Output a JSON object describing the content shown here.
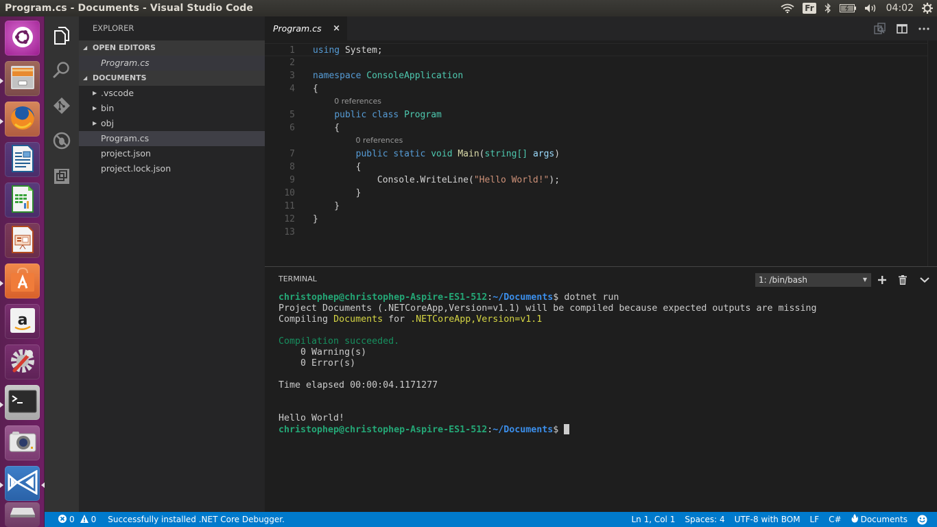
{
  "window": {
    "title": "Program.cs - Documents - Visual Studio Code"
  },
  "top_panel": {
    "keyboard_layout": "Fr",
    "clock": "04:02",
    "icons": [
      "wifi-icon",
      "keyboard-layout-indicator",
      "bluetooth-icon",
      "battery-icon",
      "volume-icon",
      "power-gear-icon"
    ]
  },
  "launcher": {
    "items": [
      {
        "name": "ubuntu-dash",
        "icon": "ubuntu-logo-icon",
        "running": false
      },
      {
        "name": "files",
        "icon": "file-cabinet-icon",
        "running": true
      },
      {
        "name": "firefox",
        "icon": "firefox-icon",
        "running": true
      },
      {
        "name": "libreoffice-writer",
        "icon": "writer-document-icon",
        "running": false
      },
      {
        "name": "libreoffice-calc",
        "icon": "calc-spreadsheet-icon",
        "running": false
      },
      {
        "name": "libreoffice-impress",
        "icon": "impress-presentation-icon",
        "running": false
      },
      {
        "name": "ubuntu-software",
        "icon": "software-center-bag-icon",
        "running": true
      },
      {
        "name": "amazon",
        "icon": "amazon-icon",
        "running": false
      },
      {
        "name": "system-settings",
        "icon": "settings-wrench-icon",
        "running": false
      },
      {
        "name": "terminal",
        "icon": "terminal-icon",
        "running": true
      },
      {
        "name": "shotwell",
        "icon": "camera-icon",
        "running": false
      },
      {
        "name": "visual-studio-code",
        "icon": "vscode-icon",
        "running": true,
        "focused": true
      },
      {
        "name": "removable-drive",
        "icon": "drive-icon",
        "running": false
      }
    ]
  },
  "activity_bar": {
    "items": [
      {
        "name": "explorer",
        "icon": "files-icon",
        "active": true
      },
      {
        "name": "search",
        "icon": "search-icon",
        "active": false
      },
      {
        "name": "source-control",
        "icon": "git-icon",
        "active": false
      },
      {
        "name": "debug",
        "icon": "debug-no-bug-icon",
        "active": false
      },
      {
        "name": "extensions",
        "icon": "extensions-icon",
        "active": false
      }
    ]
  },
  "sidebar": {
    "title": "EXPLORER",
    "open_editors": {
      "label": "OPEN EDITORS",
      "files": [
        "Program.cs"
      ]
    },
    "folder": {
      "label": "DOCUMENTS",
      "items": [
        {
          "name": ".vscode",
          "type": "folder"
        },
        {
          "name": "bin",
          "type": "folder"
        },
        {
          "name": "obj",
          "type": "folder"
        },
        {
          "name": "Program.cs",
          "type": "file",
          "selected": true
        },
        {
          "name": "project.json",
          "type": "file"
        },
        {
          "name": "project.lock.json",
          "type": "file"
        }
      ]
    }
  },
  "editor": {
    "tabs": [
      {
        "label": "Program.cs",
        "close": "×",
        "active": true
      }
    ],
    "actions": [
      "open-changes-icon",
      "split-editor-icon",
      "more-actions-icon"
    ],
    "codelens": "0 references",
    "lines": [
      {
        "n": "1",
        "tokens": [
          {
            "t": "using",
            "c": "kw"
          },
          {
            "t": " System;",
            "c": "pl"
          }
        ]
      },
      {
        "n": "2",
        "tokens": []
      },
      {
        "n": "3",
        "tokens": [
          {
            "t": "namespace",
            "c": "kw"
          },
          {
            "t": " ",
            "c": "pl"
          },
          {
            "t": "ConsoleApplication",
            "c": "ty"
          }
        ]
      },
      {
        "n": "4",
        "tokens": [
          {
            "t": "{",
            "c": "pl"
          }
        ]
      },
      {
        "n": "5",
        "tokens": [
          {
            "t": "    ",
            "c": "pl"
          },
          {
            "t": "public",
            "c": "kw"
          },
          {
            "t": " ",
            "c": "pl"
          },
          {
            "t": "class",
            "c": "kw"
          },
          {
            "t": " ",
            "c": "pl"
          },
          {
            "t": "Program",
            "c": "ty"
          }
        ]
      },
      {
        "n": "6",
        "tokens": [
          {
            "t": "    {",
            "c": "pl"
          }
        ]
      },
      {
        "n": "7",
        "tokens": [
          {
            "t": "        ",
            "c": "pl"
          },
          {
            "t": "public",
            "c": "kw"
          },
          {
            "t": " ",
            "c": "pl"
          },
          {
            "t": "static",
            "c": "kw"
          },
          {
            "t": " ",
            "c": "pl"
          },
          {
            "t": "void",
            "c": "ty"
          },
          {
            "t": " ",
            "c": "pl"
          },
          {
            "t": "Main",
            "c": "fn"
          },
          {
            "t": "(",
            "c": "pl"
          },
          {
            "t": "string[]",
            "c": "ty"
          },
          {
            "t": " ",
            "c": "pl"
          },
          {
            "t": "args",
            "c": "id"
          },
          {
            "t": ")",
            "c": "pl"
          }
        ]
      },
      {
        "n": "8",
        "tokens": [
          {
            "t": "        {",
            "c": "pl"
          }
        ]
      },
      {
        "n": "9",
        "tokens": [
          {
            "t": "            Console.WriteLine(",
            "c": "pl"
          },
          {
            "t": "\"Hello World!\"",
            "c": "str"
          },
          {
            "t": ");",
            "c": "pl"
          }
        ]
      },
      {
        "n": "10",
        "tokens": [
          {
            "t": "        }",
            "c": "pl"
          }
        ]
      },
      {
        "n": "11",
        "tokens": [
          {
            "t": "    }",
            "c": "pl"
          }
        ]
      },
      {
        "n": "12",
        "tokens": [
          {
            "t": "}",
            "c": "pl"
          }
        ]
      },
      {
        "n": "13",
        "tokens": []
      }
    ]
  },
  "panel": {
    "title": "TERMINAL",
    "terminal_select": "1: /bin/bash",
    "actions": [
      "add-terminal-icon",
      "kill-terminal-icon",
      "collapse-panel-icon"
    ],
    "prompt_user": "christophep@christophep-Aspire-ES1-512",
    "prompt_path": "~/Documents",
    "command": "dotnet run",
    "output": {
      "project_line": "Project Documents (.NETCoreApp,Version=v1.1) will be compiled because expected outputs are missing",
      "compiling_prefix": "Compiling ",
      "compiling_project": "Documents",
      "compiling_for": " for ",
      "compiling_framework": ".NETCoreApp,Version=v1.1",
      "succeeded": "Compilation succeeded.",
      "warnings": "    0 Warning(s)",
      "errors": "    0 Error(s)",
      "elapsed": "Time elapsed 00:00:04.1171277",
      "program_output": "Hello World!"
    }
  },
  "status_bar": {
    "errors": "0",
    "warnings": "0",
    "message": "Successfully installed .NET Core Debugger.",
    "position": "Ln 1, Col 1",
    "indentation": "Spaces: 4",
    "encoding": "UTF-8 with BOM",
    "eol": "LF",
    "language": "C#",
    "project": "Documents",
    "colors": {
      "background": "#007acc"
    }
  }
}
